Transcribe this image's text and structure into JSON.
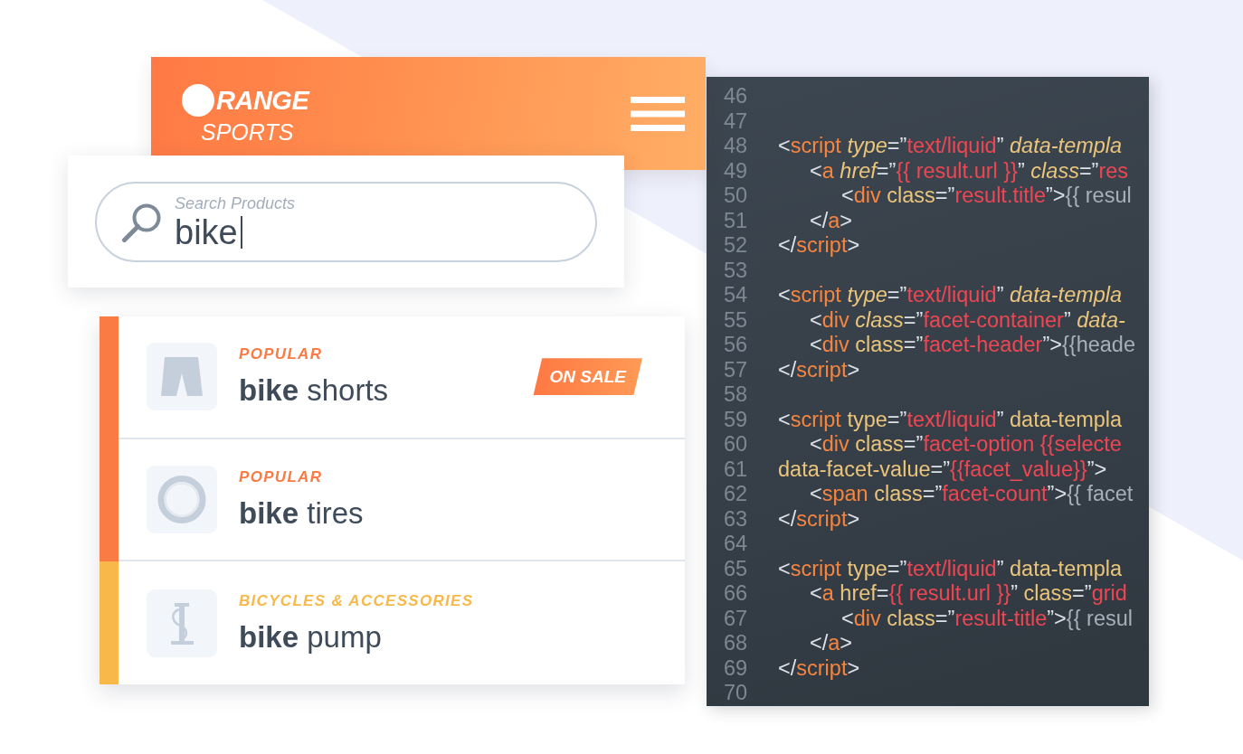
{
  "brand": {
    "name": "RANGE",
    "subtitle": "SPORTS"
  },
  "search": {
    "label": "Search Products",
    "value": "bike",
    "focused": true
  },
  "results": [
    {
      "kind": "shorts",
      "category": "POPULAR",
      "color": "#fb7b45",
      "title": "**bike** shorts",
      "badge": "ON SALE"
    },
    {
      "kind": "tire",
      "category": "POPULAR",
      "color": "#fb7b45",
      "title": "**bike** tires"
    },
    {
      "kind": "pump",
      "category": "BICYCLES & ACCESSORIES",
      "color": "#f8b84a",
      "title": "**bike** pump"
    }
  ],
  "code": {
    "lines": [
      {
        "number": "46"
      },
      {
        "number": "47"
      },
      {
        "number": "48",
        "tokens": [
          {
            "kind": "punct",
            "text": "<"
          },
          {
            "kind": "tag",
            "text": "script"
          },
          {
            "kind": "slanted",
            "text": " type"
          },
          {
            "kind": "punct",
            "text": "=”"
          },
          {
            "kind": "string",
            "text": "text/liquid"
          },
          {
            "kind": "punct",
            "text": "”"
          },
          {
            "kind": "slanted",
            "text": " data-templa"
          }
        ],
        "children": [
          {
            "number": "49",
            "tokens": [
              {
                "kind": "punct",
                "text": "<"
              },
              {
                "kind": "tag",
                "text": "a"
              },
              {
                "kind": "slanted",
                "text": " href"
              },
              {
                "kind": "punct",
                "text": "=”"
              },
              {
                "kind": "string",
                "text": "{{ result.url }}"
              },
              {
                "kind": "punct",
                "text": "”"
              },
              {
                "kind": "slanted",
                "text": " class"
              },
              {
                "kind": "punct",
                "text": "=”"
              },
              {
                "kind": "string",
                "text": "res"
              }
            ],
            "children": [
              {
                "number": "50",
                "tokens": [
                  {
                    "kind": "punct",
                    "text": "<"
                  },
                  {
                    "kind": "tag",
                    "text": "div"
                  },
                  {
                    "kind": "attr",
                    "text": " class"
                  },
                  {
                    "kind": "punct",
                    "text": "=”"
                  },
                  {
                    "kind": "string",
                    "text": "result.title"
                  },
                  {
                    "kind": "punct",
                    "text": "”>"
                  },
                  {
                    "kind": "plain",
                    "text": "{{ resul"
                  }
                ]
              }
            ]
          },
          {
            "number": "51",
            "tokens": [
              {
                "kind": "punct",
                "text": "</"
              },
              {
                "kind": "tag",
                "text": "a"
              },
              {
                "kind": "punct",
                "text": ">"
              }
            ]
          }
        ]
      },
      {
        "number": "52",
        "tokens": [
          {
            "kind": "punct",
            "text": "</"
          },
          {
            "kind": "tag",
            "text": "script"
          },
          {
            "kind": "punct",
            "text": ">"
          }
        ]
      },
      {
        "number": "53"
      },
      {
        "number": "54",
        "tokens": [
          {
            "kind": "punct",
            "text": "<"
          },
          {
            "kind": "tag",
            "text": "script"
          },
          {
            "kind": "slanted",
            "text": " type"
          },
          {
            "kind": "punct",
            "text": "=”"
          },
          {
            "kind": "string",
            "text": "text/liquid"
          },
          {
            "kind": "punct",
            "text": "”"
          },
          {
            "kind": "slanted",
            "text": " data-templa"
          }
        ],
        "children": [
          {
            "number": "55",
            "tokens": [
              {
                "kind": "punct",
                "text": "<"
              },
              {
                "kind": "tag",
                "text": "div"
              },
              {
                "kind": "slanted",
                "text": " class"
              },
              {
                "kind": "punct",
                "text": "=”"
              },
              {
                "kind": "string",
                "text": "facet-container"
              },
              {
                "kind": "punct",
                "text": "”"
              },
              {
                "kind": "slanted",
                "text": " data-"
              }
            ]
          },
          {
            "number": "56",
            "tokens": [
              {
                "kind": "punct",
                "text": "<"
              },
              {
                "kind": "tag",
                "text": "div"
              },
              {
                "kind": "attr",
                "text": " class"
              },
              {
                "kind": "punct",
                "text": "=”"
              },
              {
                "kind": "string",
                "text": "facet-header"
              },
              {
                "kind": "punct",
                "text": "”>"
              },
              {
                "kind": "plain",
                "text": "{{heade"
              }
            ]
          }
        ]
      },
      {
        "number": "57",
        "tokens": [
          {
            "kind": "punct",
            "text": "</"
          },
          {
            "kind": "tag",
            "text": "script"
          },
          {
            "kind": "punct",
            "text": ">"
          }
        ]
      },
      {
        "number": "58"
      },
      {
        "number": "59",
        "tokens": [
          {
            "kind": "punct",
            "text": "<"
          },
          {
            "kind": "tag",
            "text": "script"
          },
          {
            "kind": "attr",
            "text": " type"
          },
          {
            "kind": "punct",
            "text": "=”"
          },
          {
            "kind": "string",
            "text": "text/liquid"
          },
          {
            "kind": "punct",
            "text": "”"
          },
          {
            "kind": "attr",
            "text": " data-templa"
          }
        ],
        "children": [
          {
            "number": "60",
            "tokens": [
              {
                "kind": "punct",
                "text": "<"
              },
              {
                "kind": "tag",
                "text": "div"
              },
              {
                "kind": "attr",
                "text": " class"
              },
              {
                "kind": "punct",
                "text": "=”"
              },
              {
                "kind": "string",
                "text": "facet-option {{selecte"
              }
            ]
          }
        ]
      },
      {
        "number": "61",
        "tokens": [
          {
            "kind": "attr",
            "text": "data-facet-value"
          },
          {
            "kind": "punct",
            "text": "=”"
          },
          {
            "kind": "string",
            "text": "{{facet_value}}"
          },
          {
            "kind": "punct",
            "text": "”>"
          }
        ],
        "children": [
          {
            "number": "62",
            "tokens": [
              {
                "kind": "punct",
                "text": "<"
              },
              {
                "kind": "tag",
                "text": "span"
              },
              {
                "kind": "attr",
                "text": " class"
              },
              {
                "kind": "punct",
                "text": "=”"
              },
              {
                "kind": "string",
                "text": "facet-count"
              },
              {
                "kind": "punct",
                "text": "”>"
              },
              {
                "kind": "plain",
                "text": "{{ facet"
              }
            ]
          }
        ]
      },
      {
        "number": "63",
        "tokens": [
          {
            "kind": "punct",
            "text": "</"
          },
          {
            "kind": "tag",
            "text": "script"
          },
          {
            "kind": "punct",
            "text": ">"
          }
        ]
      },
      {
        "number": "64"
      },
      {
        "number": "65",
        "tokens": [
          {
            "kind": "punct",
            "text": "<"
          },
          {
            "kind": "tag",
            "text": "script"
          },
          {
            "kind": "attr",
            "text": " type"
          },
          {
            "kind": "punct",
            "text": "=”"
          },
          {
            "kind": "string",
            "text": "text/liquid"
          },
          {
            "kind": "punct",
            "text": "”"
          },
          {
            "kind": "attr",
            "text": " data-templa"
          }
        ],
        "children": [
          {
            "number": "66",
            "tokens": [
              {
                "kind": "punct",
                "text": "<"
              },
              {
                "kind": "tag",
                "text": "a"
              },
              {
                "kind": "attr",
                "text": " href"
              },
              {
                "kind": "punct",
                "text": "="
              },
              {
                "kind": "string",
                "text": "{{ result.url }}"
              },
              {
                "kind": "punct",
                "text": "”"
              },
              {
                "kind": "attr",
                "text": " class"
              },
              {
                "kind": "punct",
                "text": "=”"
              },
              {
                "kind": "string",
                "text": "grid"
              }
            ],
            "children": [
              {
                "number": "67",
                "tokens": [
                  {
                    "kind": "punct",
                    "text": "<"
                  },
                  {
                    "kind": "tag",
                    "text": "div"
                  },
                  {
                    "kind": "attr",
                    "text": " class"
                  },
                  {
                    "kind": "punct",
                    "text": "=”"
                  },
                  {
                    "kind": "string",
                    "text": "result-title"
                  },
                  {
                    "kind": "punct",
                    "text": "”>"
                  },
                  {
                    "kind": "plain",
                    "text": "{{ resul"
                  }
                ]
              }
            ]
          },
          {
            "number": "68",
            "tokens": [
              {
                "kind": "punct",
                "text": "</"
              },
              {
                "kind": "tag",
                "text": "a"
              },
              {
                "kind": "punct",
                "text": ">"
              }
            ]
          }
        ]
      },
      {
        "number": "69",
        "tokens": [
          {
            "kind": "punct",
            "text": "</"
          },
          {
            "kind": "tag",
            "text": "script"
          },
          {
            "kind": "punct",
            "text": ">"
          }
        ]
      },
      {
        "number": "70"
      }
    ]
  }
}
